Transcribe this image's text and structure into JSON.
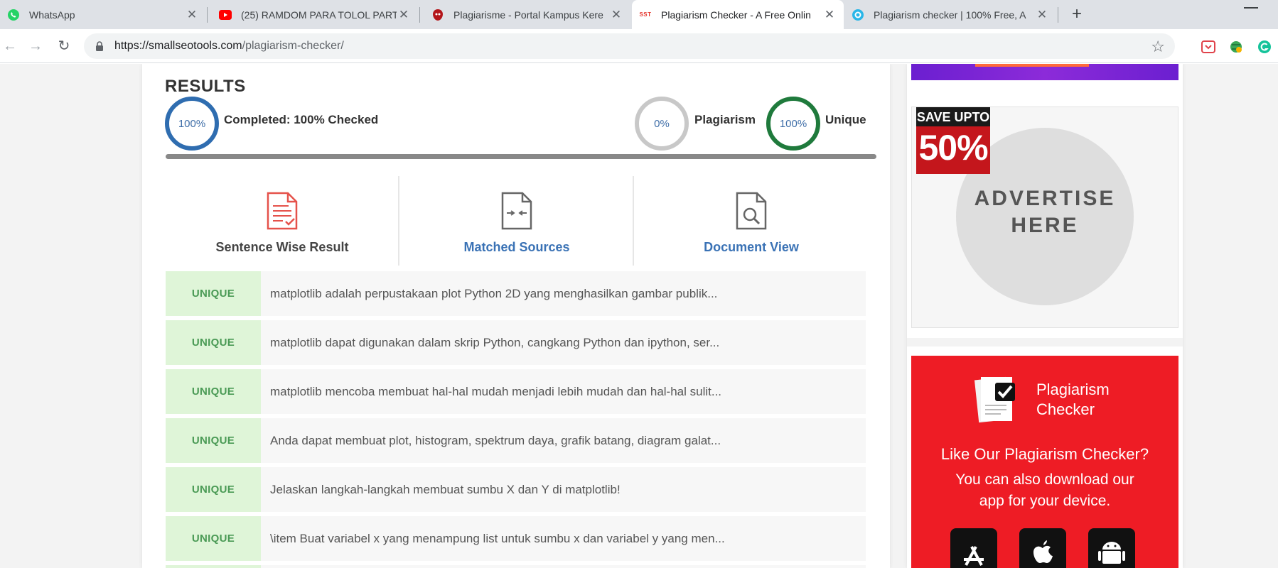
{
  "browser": {
    "tabs": [
      {
        "title": "WhatsApp",
        "icon": "whatsapp-icon",
        "active": false
      },
      {
        "title": "(25) RAMDOM PARA TOLOL PART",
        "icon": "youtube-icon",
        "active": false
      },
      {
        "title": "Plagiarisme - Portal Kampus Kere",
        "icon": "portal-icon",
        "active": false
      },
      {
        "title": "Plagiarism Checker - A Free Onlin",
        "icon": "sst-icon",
        "active": true
      },
      {
        "title": "Plagiarism checker | 100% Free, A",
        "icon": "checker-icon",
        "active": false
      }
    ],
    "sst_label": "SST",
    "url_host": "https://smallseotools.com",
    "url_path": "/plagiarism-checker/"
  },
  "results": {
    "title": "RESULTS",
    "completed_pct": "100%",
    "completed_label": "Completed: 100% Checked",
    "plagiarism_pct": "0%",
    "plagiarism_label": "Plagiarism",
    "unique_pct": "100%",
    "unique_label": "Unique",
    "progress": 1.0,
    "tabs": [
      "Sentence Wise Result",
      "Matched Sources",
      "Document View"
    ],
    "rows": [
      {
        "tag": "UNIQUE",
        "text": "matplotlib adalah perpustakaan plot Python 2D yang menghasilkan gambar publik..."
      },
      {
        "tag": "UNIQUE",
        "text": "matplotlib dapat digunakan dalam skrip Python, cangkang Python dan ipython, ser..."
      },
      {
        "tag": "UNIQUE",
        "text": "matplotlib mencoba membuat hal-hal mudah menjadi lebih mudah dan hal-hal sulit..."
      },
      {
        "tag": "UNIQUE",
        "text": "Anda dapat membuat plot, histogram, spektrum daya, grafik batang, diagram galat..."
      },
      {
        "tag": "UNIQUE",
        "text": "Jelaskan langkah-langkah membuat sumbu X dan Y di matplotlib!"
      },
      {
        "tag": "UNIQUE",
        "text": "\\item Buat variabel x yang menampung list untuk sumbu x dan variabel y yang men..."
      }
    ]
  },
  "sidebar": {
    "save_top": "SAVE UPTO",
    "save_pct": "50%",
    "advertise_line1": "ADVERTISE",
    "advertise_line2": "HERE",
    "promo_brand_line1": "Plagiarism",
    "promo_brand_line2": "Checker",
    "promo_heading": "Like Our Plagiarism Checker?",
    "promo_sub_line1": "You can also download our",
    "promo_sub_line2": "app for your device."
  },
  "colors": {
    "blue_ring": "#2f6db0",
    "grey_ring": "#c8c8c8",
    "green_ring": "#1f7a3c",
    "link_blue": "#3a72b5",
    "promo_red": "#ee1c25",
    "unique_bg": "#dff5d8"
  }
}
